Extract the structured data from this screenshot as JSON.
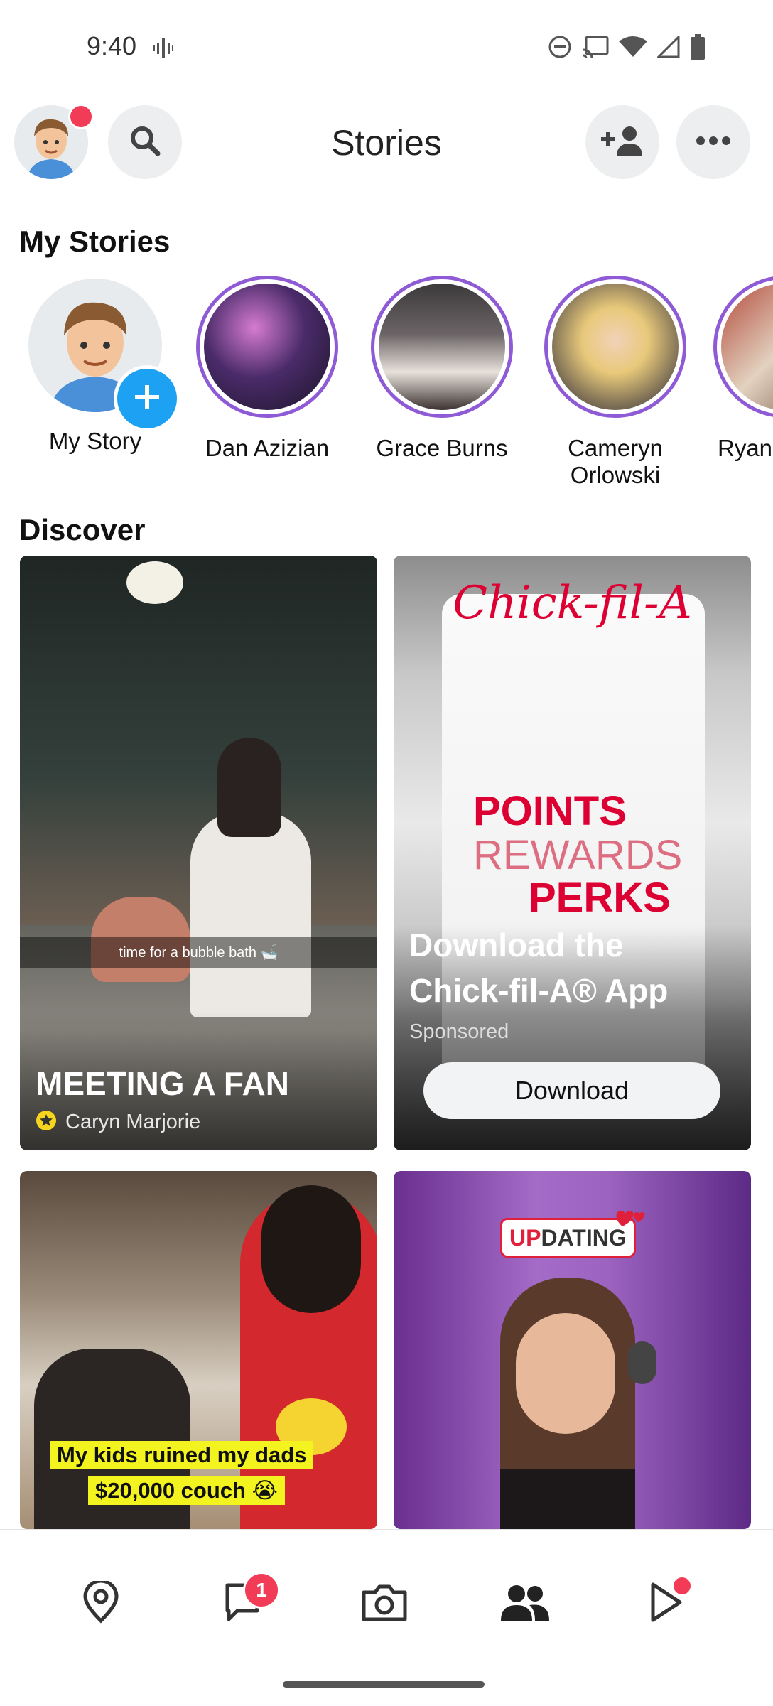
{
  "status_bar": {
    "time": "9:40"
  },
  "header": {
    "title": "Stories"
  },
  "my_stories": {
    "title": "My Stories",
    "items": [
      {
        "name": "My Story"
      },
      {
        "name": "Dan Azizian"
      },
      {
        "name": "Grace Burns"
      },
      {
        "name": "Cameryn Orlowski"
      },
      {
        "name": "Ryan"
      }
    ]
  },
  "discover": {
    "title": "Discover",
    "cards": [
      {
        "caption": "time for a bubble bath 🛁",
        "title": "MEETING A FAN",
        "creator": "Caryn Marjorie"
      },
      {
        "brand": "Chick-fil-A",
        "promo_1": "POINTS",
        "promo_2": "REWARDS",
        "promo_3": "PERKS",
        "title": "Download the Chick-fil-A® App",
        "sponsored": "Sponsored",
        "button": "Download"
      },
      {
        "caption_1": "My kids ruined my dads",
        "caption_2": "$20,000 couch 😭"
      },
      {
        "logo_1": "UP",
        "logo_2": "DATING"
      }
    ]
  },
  "bottom_nav": {
    "chat_badge": "1"
  },
  "colors": {
    "accent_ring": "#8f5ad6",
    "notify_red": "#f23c57",
    "blue": "#1da1f2"
  }
}
